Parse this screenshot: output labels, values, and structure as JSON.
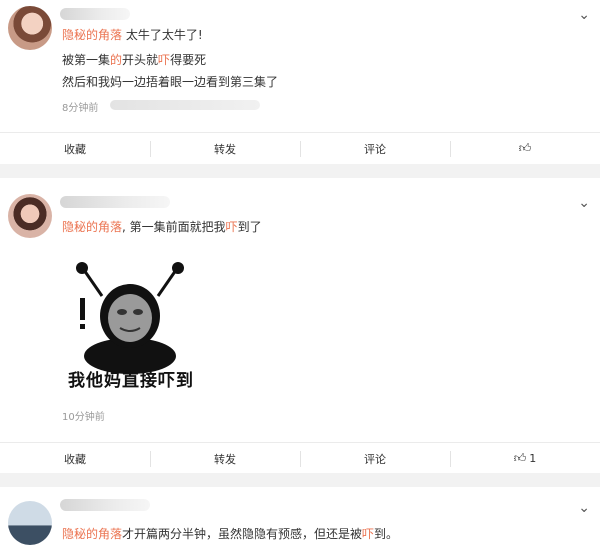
{
  "posts": [
    {
      "author": "隐秘的角落",
      "text1_rest": " 太牛了太牛了!",
      "line2_a": "被第一集",
      "line2_hl": "的",
      "line2_b": "开头就",
      "line2_hl2": "吓",
      "line2_c": "得要死",
      "line3": "然后和我妈一边捂着眼一边看到第三集了",
      "time": "8分钟前",
      "actions": {
        "fav": "收藏",
        "repost": "转发",
        "comment": "评论",
        "likes": ""
      }
    },
    {
      "author": "隐秘的角落",
      "text_a": ", 第一集前面就把我",
      "text_hl": "吓",
      "text_b": "到了",
      "meme_caption_a": "我他妈直接",
      "meme_caption_b": "吓到",
      "time": "10分钟前",
      "actions": {
        "fav": "收藏",
        "repost": "转发",
        "comment": "评论",
        "likes": "1"
      }
    },
    {
      "author": "隐秘的角落",
      "text_a": "才开篇两分半钟，虽然隐隐有预感，但还是被",
      "text_hl": "吓",
      "text_b": "到。"
    }
  ],
  "colors": {
    "highlight": "#eb7350",
    "background": "#f2f2f2"
  },
  "icons": {
    "menu": "chevron-down-icon",
    "like": "thumbs-up-icon"
  }
}
